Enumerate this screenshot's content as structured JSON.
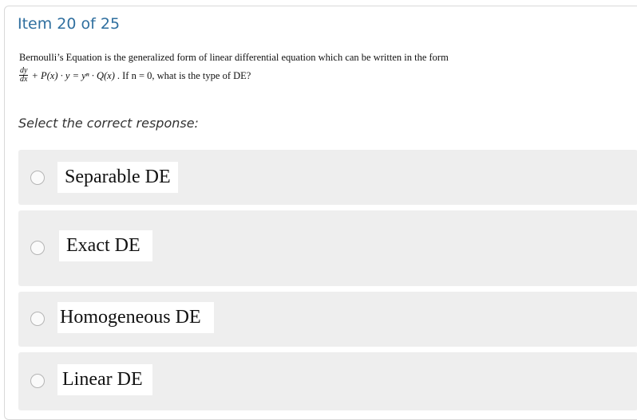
{
  "item": {
    "header": "Item 20 of 25"
  },
  "question": {
    "line1": "Bernoulli’s Equation is the generalized form of linear differential equation which can be written in the form",
    "frac_num": "dy",
    "frac_den": "dx",
    "equation": "+ P(x) · y = yⁿ · Q(x)",
    "line2_text": ". If n = 0, what is the type of DE?"
  },
  "prompt": "Select the correct response:",
  "options": [
    {
      "label": "Separable DE"
    },
    {
      "label": "Exact DE"
    },
    {
      "label": "Homogeneous DE"
    },
    {
      "label": "Linear DE"
    }
  ]
}
